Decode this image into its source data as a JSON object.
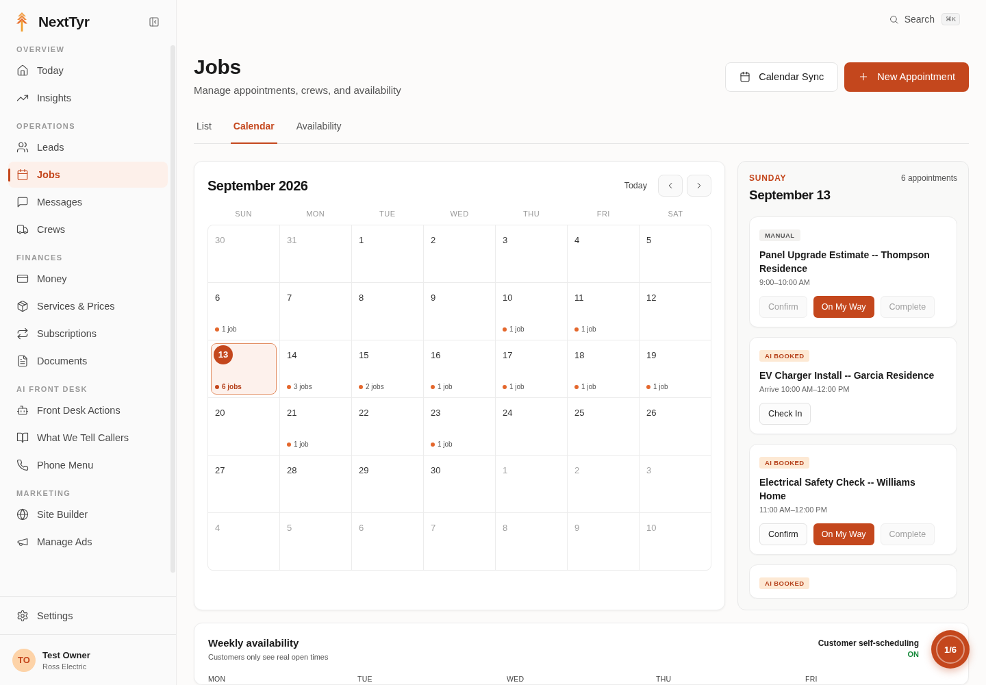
{
  "sidebar": {
    "brand": "NextTyr",
    "sections": [
      {
        "label": "OVERVIEW",
        "items": [
          {
            "label": "Today",
            "selected": false
          },
          {
            "label": "Insights",
            "selected": false
          }
        ]
      },
      {
        "label": "OPERATIONS",
        "items": [
          {
            "label": "Leads",
            "selected": false
          },
          {
            "label": "Jobs",
            "selected": true
          },
          {
            "label": "Messages",
            "selected": false
          },
          {
            "label": "Crews",
            "selected": false
          }
        ]
      },
      {
        "label": "FINANCES",
        "items": [
          {
            "label": "Money",
            "selected": false
          },
          {
            "label": "Services & Prices",
            "selected": false
          },
          {
            "label": "Subscriptions",
            "selected": false
          },
          {
            "label": "Documents",
            "selected": false
          }
        ]
      },
      {
        "label": "AI FRONT DESK",
        "items": [
          {
            "label": "Front Desk Actions",
            "selected": false
          },
          {
            "label": "What We Tell Callers",
            "selected": false
          },
          {
            "label": "Phone Menu",
            "selected": false
          }
        ]
      },
      {
        "label": "MARKETING",
        "items": [
          {
            "label": "Site Builder",
            "selected": false
          },
          {
            "label": "Manage Ads",
            "selected": false
          }
        ]
      }
    ],
    "settings": {
      "label": "Settings",
      "selected": false
    },
    "user": {
      "initials": "TO",
      "name": "Test Owner",
      "company": "Ross Electric"
    }
  },
  "header": {
    "search": {
      "label": "Search",
      "shortcut": "⌘K"
    },
    "title": "Jobs",
    "subtitle": "Manage appointments, crews, and availability",
    "buttons": [
      {
        "label": "Calendar Sync",
        "kind": "secondary"
      },
      {
        "label": "New Appointment",
        "kind": "primary"
      }
    ]
  },
  "tabs": [
    {
      "label": "List",
      "selected": false
    },
    {
      "label": "Calendar",
      "selected": true
    },
    {
      "label": "Availability",
      "selected": false
    }
  ],
  "calendar": {
    "title": "September 2026",
    "today_label": "Today",
    "weekdays": [
      "SUN",
      "MON",
      "TUE",
      "WED",
      "THU",
      "FRI",
      "SAT"
    ],
    "days": [
      {
        "day": "30",
        "outside_month": true,
        "selected": false
      },
      {
        "day": "31",
        "outside_month": true,
        "selected": false
      },
      {
        "day": "1",
        "outside_month": false,
        "selected": false
      },
      {
        "day": "2",
        "outside_month": false,
        "selected": false
      },
      {
        "day": "3",
        "outside_month": false,
        "selected": false
      },
      {
        "day": "4",
        "outside_month": false,
        "selected": false
      },
      {
        "day": "5",
        "outside_month": false,
        "selected": false
      },
      {
        "day": "6",
        "outside_month": false,
        "selected": false,
        "jobs": "1 job"
      },
      {
        "day": "7",
        "outside_month": false,
        "selected": false
      },
      {
        "day": "8",
        "outside_month": false,
        "selected": false
      },
      {
        "day": "9",
        "outside_month": false,
        "selected": false
      },
      {
        "day": "10",
        "outside_month": false,
        "selected": false,
        "jobs": "1 job"
      },
      {
        "day": "11",
        "outside_month": false,
        "selected": false,
        "jobs": "1 job"
      },
      {
        "day": "12",
        "outside_month": false,
        "selected": false
      },
      {
        "day": "13",
        "outside_month": false,
        "selected": true,
        "jobs": "6 jobs"
      },
      {
        "day": "14",
        "outside_month": false,
        "selected": false,
        "jobs": "3 jobs"
      },
      {
        "day": "15",
        "outside_month": false,
        "selected": false,
        "jobs": "2 jobs"
      },
      {
        "day": "16",
        "outside_month": false,
        "selected": false,
        "jobs": "1 job"
      },
      {
        "day": "17",
        "outside_month": false,
        "selected": false,
        "jobs": "1 job"
      },
      {
        "day": "18",
        "outside_month": false,
        "selected": false,
        "jobs": "1 job"
      },
      {
        "day": "19",
        "outside_month": false,
        "selected": false,
        "jobs": "1 job"
      },
      {
        "day": "20",
        "outside_month": false,
        "selected": false
      },
      {
        "day": "21",
        "outside_month": false,
        "selected": false,
        "jobs": "1 job"
      },
      {
        "day": "22",
        "outside_month": false,
        "selected": false
      },
      {
        "day": "23",
        "outside_month": false,
        "selected": false,
        "jobs": "1 job"
      },
      {
        "day": "24",
        "outside_month": false,
        "selected": false
      },
      {
        "day": "25",
        "outside_month": false,
        "selected": false
      },
      {
        "day": "26",
        "outside_month": false,
        "selected": false
      },
      {
        "day": "27",
        "outside_month": false,
        "selected": false
      },
      {
        "day": "28",
        "outside_month": false,
        "selected": false
      },
      {
        "day": "29",
        "outside_month": false,
        "selected": false
      },
      {
        "day": "30",
        "outside_month": false,
        "selected": false
      },
      {
        "day": "1",
        "outside_month": true,
        "selected": false
      },
      {
        "day": "2",
        "outside_month": true,
        "selected": false
      },
      {
        "day": "3",
        "outside_month": true,
        "selected": false
      },
      {
        "day": "4",
        "outside_month": true,
        "selected": false
      },
      {
        "day": "5",
        "outside_month": true,
        "selected": false
      },
      {
        "day": "6",
        "outside_month": true,
        "selected": false
      },
      {
        "day": "7",
        "outside_month": true,
        "selected": false
      },
      {
        "day": "8",
        "outside_month": true,
        "selected": false
      },
      {
        "day": "9",
        "outside_month": true,
        "selected": false
      },
      {
        "day": "10",
        "outside_month": true,
        "selected": false
      }
    ]
  },
  "day_panel": {
    "weekday": "SUNDAY",
    "date": "September 13",
    "count": "6 appointments",
    "appointments": [
      {
        "tag": "MANUAL",
        "kind": "manual",
        "title": "Panel Upgrade Estimate -- Thompson Residence",
        "time": "9:00–10:00 AM",
        "actions": [
          {
            "label": "Confirm",
            "kind": "outline",
            "disabled": true
          },
          {
            "label": "On My Way",
            "kind": "primary",
            "disabled": false
          },
          {
            "label": "Complete",
            "kind": "outline",
            "disabled": true
          }
        ]
      },
      {
        "tag": "AI BOOKED",
        "kind": "ai",
        "title": "EV Charger Install -- Garcia Residence",
        "time": "Arrive 10:00 AM–12:00 PM",
        "actions": [
          {
            "label": "Check In",
            "kind": "outline",
            "disabled": false
          }
        ]
      },
      {
        "tag": "AI BOOKED",
        "kind": "ai",
        "title": "Electrical Safety Check -- Williams Home",
        "time": "11:00 AM–12:00 PM",
        "actions": [
          {
            "label": "Confirm",
            "kind": "outline",
            "disabled": false
          },
          {
            "label": "On My Way",
            "kind": "primary",
            "disabled": false
          },
          {
            "label": "Complete",
            "kind": "outline",
            "disabled": true
          }
        ]
      },
      {
        "tag": "AI BOOKED",
        "kind": "ai"
      }
    ]
  },
  "weekly_availability": {
    "title": "Weekly availability",
    "subtitle": "Customers only see real open times",
    "self_scheduling": {
      "label": "Customer self-scheduling",
      "status": "ON",
      "on": true
    },
    "days": [
      "MON",
      "TUE",
      "WED",
      "THU",
      "FRI"
    ]
  },
  "progress_badge": {
    "label": "1/6"
  }
}
